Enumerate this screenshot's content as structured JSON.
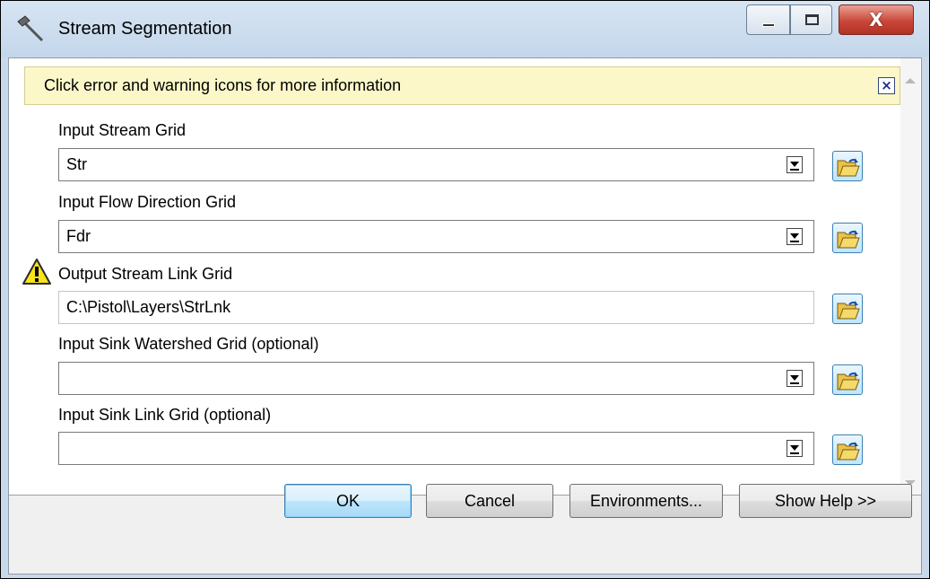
{
  "window": {
    "title": "Stream Segmentation",
    "close_glyph": "X"
  },
  "infobar": {
    "message": "Click error and warning icons for more information",
    "close_glyph": "×"
  },
  "fields": [
    {
      "label": "Input Stream Grid",
      "value": "Str",
      "kind": "combo"
    },
    {
      "label": "Input Flow Direction Grid",
      "value": "Fdr",
      "kind": "combo"
    },
    {
      "label": "Output Stream Link Grid",
      "value": "C:\\Pistol\\Layers\\StrLnk",
      "kind": "text",
      "status": "warning"
    },
    {
      "label": "Input Sink Watershed Grid (optional)",
      "value": "",
      "kind": "combo"
    },
    {
      "label": "Input Sink Link Grid (optional)",
      "value": "",
      "kind": "combo"
    }
  ],
  "buttons": {
    "ok": "OK",
    "cancel": "Cancel",
    "environments": "Environments...",
    "show_help": "Show Help >>"
  },
  "icons": {
    "title": "hammer-icon",
    "warning": "warning-icon",
    "browse": "open-folder-icon"
  },
  "colors": {
    "infobar_bg": "#fbf7c8",
    "close_button": "#c9473a",
    "ok_button": "#bee6fd"
  }
}
